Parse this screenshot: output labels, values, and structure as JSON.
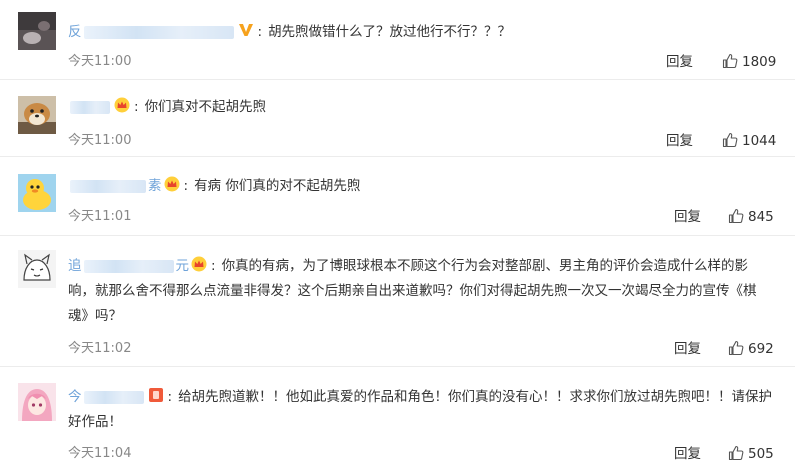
{
  "comments": [
    {
      "name_prefix": "反",
      "name_suffix": "",
      "text": "胡先煦做错什么了？放过他行不行？？？",
      "time": "今天11:00",
      "reply": "回复",
      "likes": "1809",
      "badge_icon": "vip-v-icon",
      "avatar_icon": "dark-photo-avatar"
    },
    {
      "name_prefix": "",
      "name_suffix": "",
      "text": "你们真对不起胡先煦",
      "time": "今天11:00",
      "reply": "回复",
      "likes": "1044",
      "badge_icon": "crown-member-icon",
      "avatar_icon": "shiba-dog-avatar"
    },
    {
      "name_prefix": "",
      "name_suffix": "素",
      "text": "有病 你们真的对不起胡先煦",
      "time": "今天11:01",
      "reply": "回复",
      "likes": "845",
      "badge_icon": "crown-member-icon",
      "avatar_icon": "yellow-duck-avatar"
    },
    {
      "name_prefix": "追",
      "name_suffix": "元",
      "text": "你真的有病，为了博眼球根本不顾这个行为会对整部剧、男主角的评价会造成什么样的影响，就那么舍不得那么点流量非得发？这个后期亲自出来道歉吗？你们对得起胡先煦一次又一次竭尽全力的宣传《棋魂》吗？",
      "time": "今天11:02",
      "reply": "回复",
      "likes": "692",
      "badge_icon": "crown-member-icon",
      "avatar_icon": "sketch-cat-avatar"
    },
    {
      "name_prefix": "今",
      "name_suffix": "",
      "text": "给胡先煦道歉！！他如此真爱的作品和角色！你们真的没有心！！求求你们放过胡先煦吧！！请保护好作品！",
      "time": "今天11:04",
      "reply": "回复",
      "likes": "505",
      "badge_icon": "red-member-icon",
      "avatar_icon": "anime-girl-avatar"
    }
  ]
}
